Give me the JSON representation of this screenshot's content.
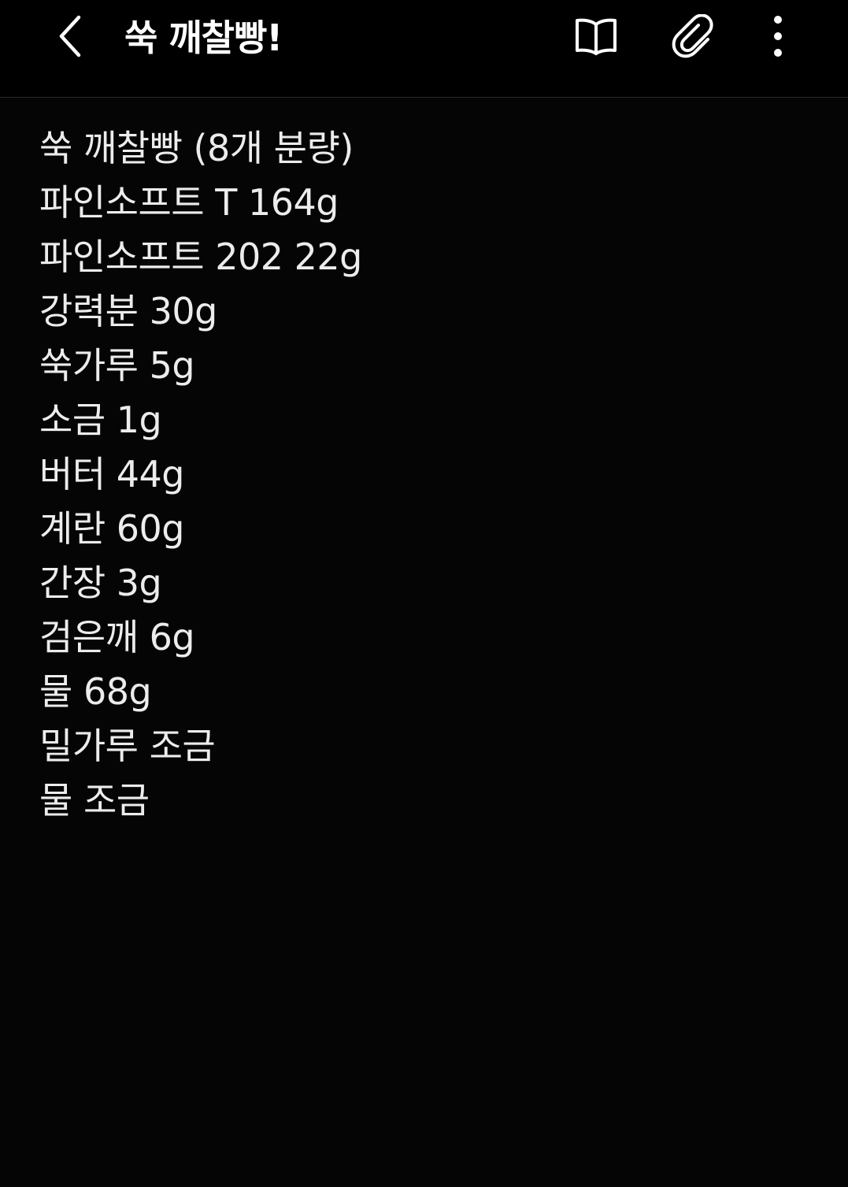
{
  "app_bar": {
    "title": "쑥 깨찰빵!",
    "back_icon": "chevron-left-icon",
    "reader_icon": "open-book-icon",
    "attach_icon": "paperclip-icon",
    "more_icon": "vertical-dots-icon"
  },
  "note": {
    "lines": [
      "쑥 깨찰빵 (8개 분량)",
      "파인소프트 T 164g",
      "파인소프트 202 22g",
      "강력분 30g",
      "쑥가루 5g",
      "소금 1g",
      "버터 44g",
      "계란 60g",
      "간장 3g",
      "검은깨 6g",
      "물 68g",
      "밀가루 조금",
      "물 조금"
    ]
  },
  "colors": {
    "background": "#050505",
    "app_bar": "#000000",
    "text": "#ececec",
    "title": "#ffffff"
  }
}
